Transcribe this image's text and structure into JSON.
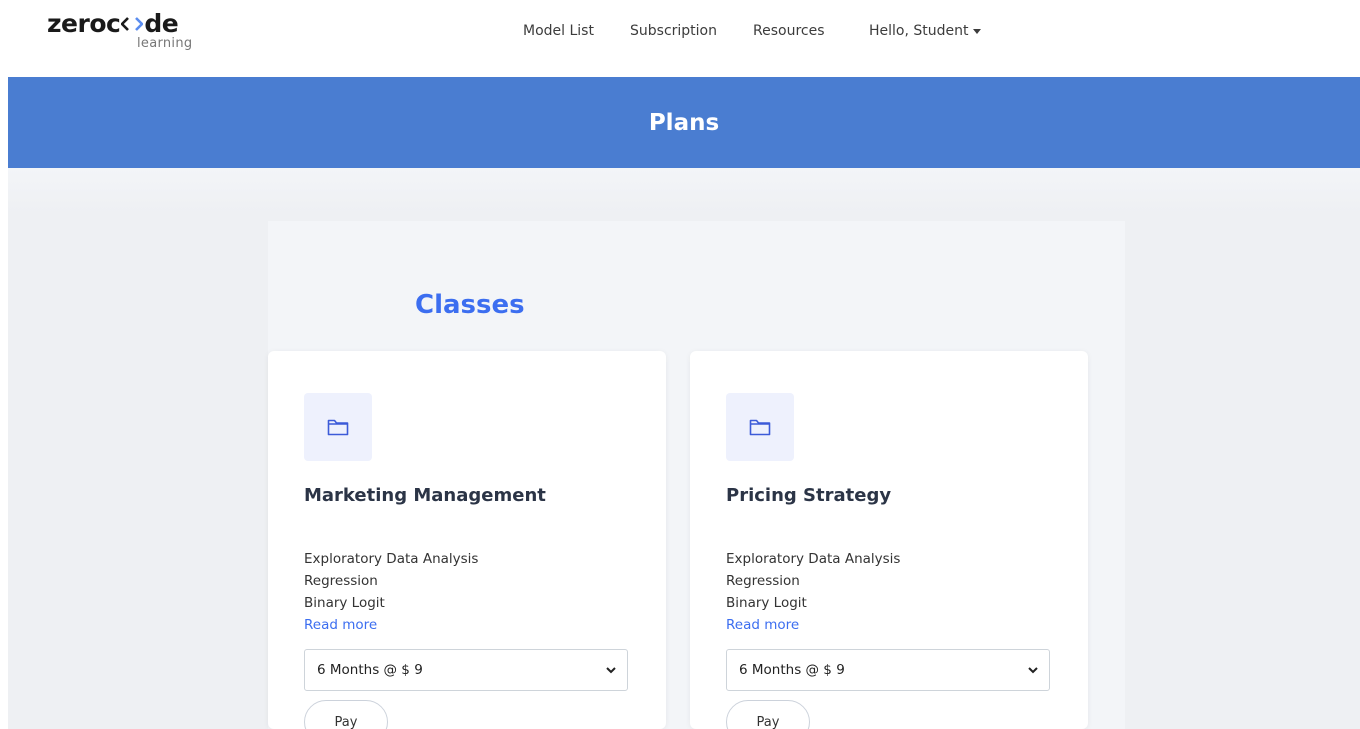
{
  "header": {
    "logo_prefix": "zeroc",
    "logo_suffix": "de",
    "logo_sub": "learning",
    "nav": {
      "model_list": "Model List",
      "subscription": "Subscription",
      "resources": "Resources",
      "user_greeting": "Hello, Student"
    }
  },
  "banner": {
    "title": "Plans"
  },
  "section": {
    "title": "Classes"
  },
  "cards": [
    {
      "title": "Marketing Management",
      "features": [
        "Exploratory Data Analysis",
        "Regression",
        "Binary Logit"
      ],
      "read_more": "Read more",
      "plan_selected": "6 Months @ $ 9",
      "pay_label": "Pay"
    },
    {
      "title": "Pricing Strategy",
      "features": [
        "Exploratory Data Analysis",
        "Regression",
        "Binary Logit"
      ],
      "read_more": "Read more",
      "plan_selected": "6 Months @ $ 9",
      "pay_label": "Pay"
    }
  ],
  "colors": {
    "banner": "#4a7dd1",
    "accent": "#3c6ef0",
    "icon_bg": "#eef1fd"
  }
}
